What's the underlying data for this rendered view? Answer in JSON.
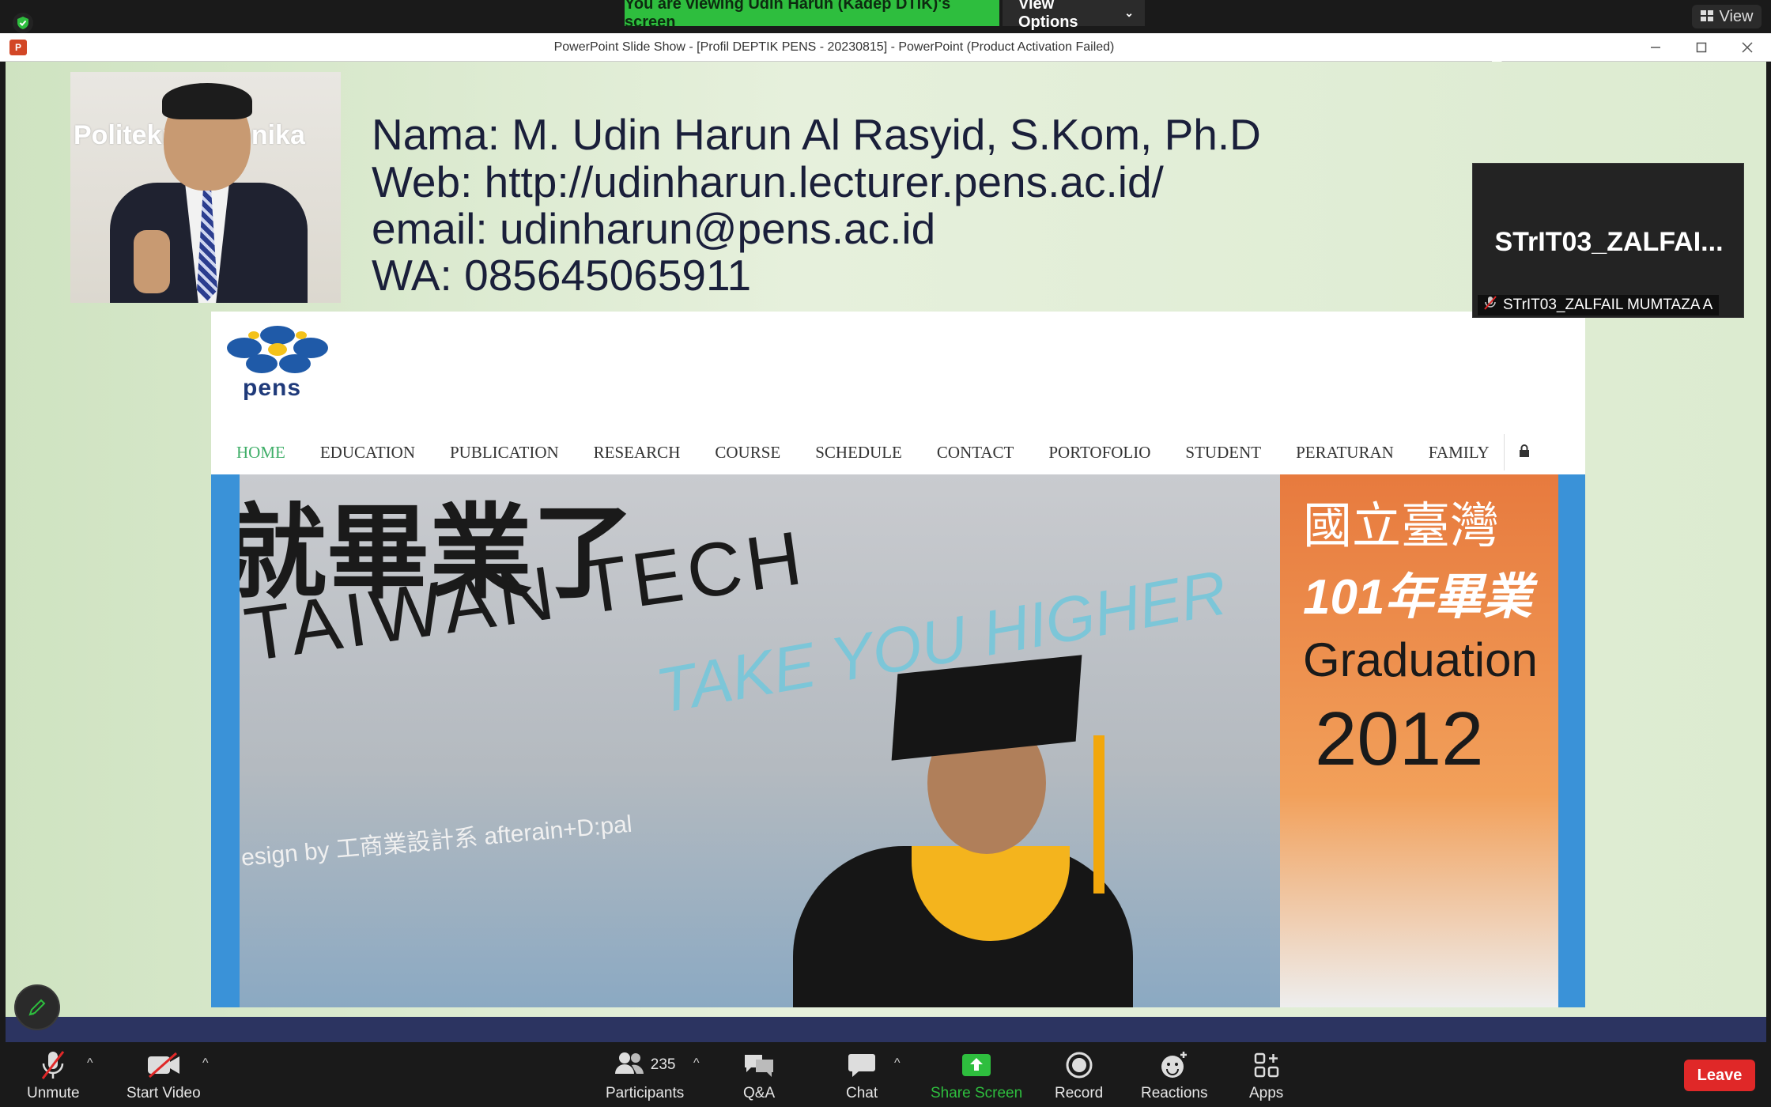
{
  "zoom_top": {
    "viewing_banner": "You are viewing Udin Harun (Kadep DTIK)'s screen",
    "view_options": "View Options",
    "view_button": "View"
  },
  "ppt": {
    "window_title": "PowerPoint Slide Show - [Profil DEPTIK PENS - 20230815] - PowerPoint (Product Activation Failed)",
    "min_icon": "minimize-icon",
    "restore_icon": "restore-icon",
    "close_icon": "close-icon"
  },
  "slide": {
    "photo_wall_text": "Politekn   ektronika",
    "info": {
      "name": "Nama: M. Udin Harun Al Rasyid, S.Kom, Ph.D",
      "web": "Web: http://udinharun.lecturer.pens.ac.id/",
      "email": "email: udinharun@pens.ac.id",
      "wa": "WA: 085645065911"
    },
    "website": {
      "logo_text": "pens",
      "nav": [
        "HOME",
        "EDUCATION",
        "PUBLICATION",
        "RESEARCH",
        "COURSE",
        "SCHEDULE",
        "CONTACT",
        "PORTOFOLIO",
        "STUDENT",
        "PERATURAN",
        "FAMILY"
      ],
      "active_nav": "HOME",
      "hero": {
        "cn_line": "就畢業了",
        "taiwan_tech": "TAIWAN TECH",
        "slogan": "TAKE YOU HIGHER",
        "design_by": "esign by 工商業設計系 afterain+D:pal",
        "banner_line1": "國立臺灣",
        "banner_line2": "101年畢業",
        "banner_line3": "Graduation",
        "banner_line4": "2012"
      }
    }
  },
  "participant_tile": {
    "display_name": "STrIT03_ZALFAI...",
    "label": "STrIT03_ZALFAIL MUMTAZA A"
  },
  "toolbar": {
    "unmute": "Unmute",
    "start_video": "Start Video",
    "participants": "Participants",
    "participants_count": "235",
    "qa": "Q&A",
    "chat": "Chat",
    "share_screen": "Share Screen",
    "record": "Record",
    "reactions": "Reactions",
    "apps": "Apps",
    "leave": "Leave"
  },
  "colors": {
    "zoom_green": "#2ebe3e",
    "leave_red": "#e02828",
    "nav_active": "#3fae68",
    "hero_border_blue": "#3a92d8"
  }
}
